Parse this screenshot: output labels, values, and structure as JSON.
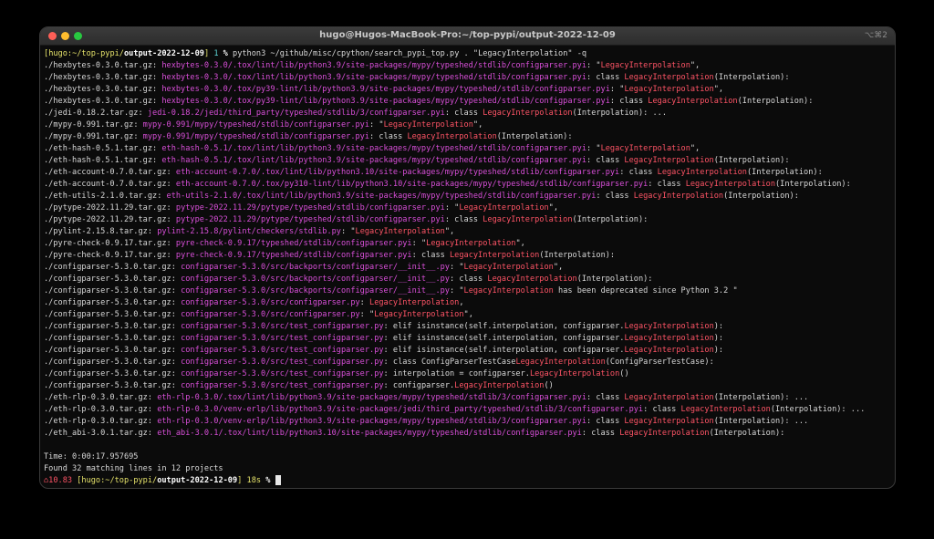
{
  "window": {
    "title": "hugo@Hugos-MacBook-Pro:~/top-pypi/output-2022-12-09",
    "shortcut": "⌥⌘2"
  },
  "prompt1": {
    "open": "[",
    "user": "hugo",
    "path_prefix": ":~/top-pypi/",
    "path_bold": "output-2022-12-09",
    "close": "]",
    "count": " 1 ",
    "symbol": "%",
    "command": " python3 ~/github/misc/cpython/search_pypi_top.py . \"LegacyInterpolation\" -q"
  },
  "results": [
    {
      "pkg": "./hexbytes-0.3.0.tar.gz",
      "path": "hexbytes-0.3.0/.tox/lint/lib/python3.9/site-packages/mypy/typeshed/stdlib/configparser.pyi",
      "pre": "\"",
      "match": "LegacyInterpolation",
      "post": "\","
    },
    {
      "pkg": "./hexbytes-0.3.0.tar.gz",
      "path": "hexbytes-0.3.0/.tox/lint/lib/python3.9/site-packages/mypy/typeshed/stdlib/configparser.pyi",
      "pre": "class ",
      "match": "LegacyInterpolation",
      "post": "(Interpolation):"
    },
    {
      "pkg": "./hexbytes-0.3.0.tar.gz",
      "path": "hexbytes-0.3.0/.tox/py39-lint/lib/python3.9/site-packages/mypy/typeshed/stdlib/configparser.pyi",
      "pre": "\"",
      "match": "LegacyInterpolation",
      "post": "\","
    },
    {
      "pkg": "./hexbytes-0.3.0.tar.gz",
      "path": "hexbytes-0.3.0/.tox/py39-lint/lib/python3.9/site-packages/mypy/typeshed/stdlib/configparser.pyi",
      "pre": "class ",
      "match": "LegacyInterpolation",
      "post": "(Interpolation):"
    },
    {
      "pkg": "./jedi-0.18.2.tar.gz",
      "path": "jedi-0.18.2/jedi/third_party/typeshed/stdlib/3/configparser.pyi",
      "pre": "class ",
      "match": "LegacyInterpolation",
      "post": "(Interpolation): ..."
    },
    {
      "pkg": "./mypy-0.991.tar.gz",
      "path": "mypy-0.991/mypy/typeshed/stdlib/configparser.pyi",
      "pre": "\"",
      "match": "LegacyInterpolation",
      "post": "\","
    },
    {
      "pkg": "./mypy-0.991.tar.gz",
      "path": "mypy-0.991/mypy/typeshed/stdlib/configparser.pyi",
      "pre": "class ",
      "match": "LegacyInterpolation",
      "post": "(Interpolation):"
    },
    {
      "pkg": "./eth-hash-0.5.1.tar.gz",
      "path": "eth-hash-0.5.1/.tox/lint/lib/python3.9/site-packages/mypy/typeshed/stdlib/configparser.pyi",
      "pre": "\"",
      "match": "LegacyInterpolation",
      "post": "\","
    },
    {
      "pkg": "./eth-hash-0.5.1.tar.gz",
      "path": "eth-hash-0.5.1/.tox/lint/lib/python3.9/site-packages/mypy/typeshed/stdlib/configparser.pyi",
      "pre": "class ",
      "match": "LegacyInterpolation",
      "post": "(Interpolation):"
    },
    {
      "pkg": "./eth-account-0.7.0.tar.gz",
      "path": "eth-account-0.7.0/.tox/lint/lib/python3.10/site-packages/mypy/typeshed/stdlib/configparser.pyi",
      "pre": "class ",
      "match": "LegacyInterpolation",
      "post": "(Interpolation):"
    },
    {
      "pkg": "./eth-account-0.7.0.tar.gz",
      "path": "eth-account-0.7.0/.tox/py310-lint/lib/python3.10/site-packages/mypy/typeshed/stdlib/configparser.pyi",
      "pre": "class ",
      "match": "LegacyInterpolation",
      "post": "(Interpolation):"
    },
    {
      "pkg": "./eth-utils-2.1.0.tar.gz",
      "path": "eth-utils-2.1.0/.tox/lint/lib/python3.9/site-packages/mypy/typeshed/stdlib/configparser.pyi",
      "pre": "class ",
      "match": "LegacyInterpolation",
      "post": "(Interpolation):"
    },
    {
      "pkg": "./pytype-2022.11.29.tar.gz",
      "path": "pytype-2022.11.29/pytype/typeshed/stdlib/configparser.pyi",
      "pre": "\"",
      "match": "LegacyInterpolation",
      "post": "\","
    },
    {
      "pkg": "./pytype-2022.11.29.tar.gz",
      "path": "pytype-2022.11.29/pytype/typeshed/stdlib/configparser.pyi",
      "pre": "class ",
      "match": "LegacyInterpolation",
      "post": "(Interpolation):"
    },
    {
      "pkg": "./pylint-2.15.8.tar.gz",
      "path": "pylint-2.15.8/pylint/checkers/stdlib.py",
      "pre": "\"",
      "match": "LegacyInterpolation",
      "post": "\","
    },
    {
      "pkg": "./pyre-check-0.9.17.tar.gz",
      "path": "pyre-check-0.9.17/typeshed/stdlib/configparser.pyi",
      "pre": "\"",
      "match": "LegacyInterpolation",
      "post": "\","
    },
    {
      "pkg": "./pyre-check-0.9.17.tar.gz",
      "path": "pyre-check-0.9.17/typeshed/stdlib/configparser.pyi",
      "pre": "class ",
      "match": "LegacyInterpolation",
      "post": "(Interpolation):"
    },
    {
      "pkg": "./configparser-5.3.0.tar.gz",
      "path": "configparser-5.3.0/src/backports/configparser/__init__.py",
      "pre": "\"",
      "match": "LegacyInterpolation",
      "post": "\","
    },
    {
      "pkg": "./configparser-5.3.0.tar.gz",
      "path": "configparser-5.3.0/src/backports/configparser/__init__.py",
      "pre": "class ",
      "match": "LegacyInterpolation",
      "post": "(Interpolation):"
    },
    {
      "pkg": "./configparser-5.3.0.tar.gz",
      "path": "configparser-5.3.0/src/backports/configparser/__init__.py",
      "pre": "\"",
      "match": "LegacyInterpolation",
      "post": " has been deprecated since Python 3.2 \""
    },
    {
      "pkg": "./configparser-5.3.0.tar.gz",
      "path": "configparser-5.3.0/src/configparser.py",
      "pre": "",
      "match": "LegacyInterpolation",
      "post": ","
    },
    {
      "pkg": "./configparser-5.3.0.tar.gz",
      "path": "configparser-5.3.0/src/configparser.py",
      "pre": "\"",
      "match": "LegacyInterpolation",
      "post": "\","
    },
    {
      "pkg": "./configparser-5.3.0.tar.gz",
      "path": "configparser-5.3.0/src/test_configparser.py",
      "pre": "elif isinstance(self.interpolation, configparser.",
      "match": "LegacyInterpolation",
      "post": "):"
    },
    {
      "pkg": "./configparser-5.3.0.tar.gz",
      "path": "configparser-5.3.0/src/test_configparser.py",
      "pre": "elif isinstance(self.interpolation, configparser.",
      "match": "LegacyInterpolation",
      "post": "):"
    },
    {
      "pkg": "./configparser-5.3.0.tar.gz",
      "path": "configparser-5.3.0/src/test_configparser.py",
      "pre": "elif isinstance(self.interpolation, configparser.",
      "match": "LegacyInterpolation",
      "post": "):"
    },
    {
      "pkg": "./configparser-5.3.0.tar.gz",
      "path": "configparser-5.3.0/src/test_configparser.py",
      "pre": "class ConfigParserTestCase",
      "match": "LegacyInterpolation",
      "post": "(ConfigParserTestCase):"
    },
    {
      "pkg": "./configparser-5.3.0.tar.gz",
      "path": "configparser-5.3.0/src/test_configparser.py",
      "pre": "interpolation = configparser.",
      "match": "LegacyInterpolation",
      "post": "()"
    },
    {
      "pkg": "./configparser-5.3.0.tar.gz",
      "path": "configparser-5.3.0/src/test_configparser.py",
      "pre": "configparser.",
      "match": "LegacyInterpolation",
      "post": "()"
    },
    {
      "pkg": "./eth-rlp-0.3.0.tar.gz",
      "path": "eth-rlp-0.3.0/.tox/lint/lib/python3.9/site-packages/mypy/typeshed/stdlib/3/configparser.pyi",
      "pre": "class ",
      "match": "LegacyInterpolation",
      "post": "(Interpolation): ..."
    },
    {
      "pkg": "./eth-rlp-0.3.0.tar.gz",
      "path": "eth-rlp-0.3.0/venv-erlp/lib/python3.9/site-packages/jedi/third_party/typeshed/stdlib/3/configparser.pyi",
      "pre": "class ",
      "match": "LegacyInterpolation",
      "post": "(Interpolation): ..."
    },
    {
      "pkg": "./eth-rlp-0.3.0.tar.gz",
      "path": "eth-rlp-0.3.0/venv-erlp/lib/python3.9/site-packages/mypy/typeshed/stdlib/3/configparser.pyi",
      "pre": "class ",
      "match": "LegacyInterpolation",
      "post": "(Interpolation): ..."
    },
    {
      "pkg": "./eth_abi-3.0.1.tar.gz",
      "path": "eth_abi-3.0.1/.tox/lint/lib/python3.10/site-packages/mypy/typeshed/stdlib/configparser.pyi",
      "pre": "class ",
      "match": "LegacyInterpolation",
      "post": "(Interpolation):"
    }
  ],
  "summary": {
    "time": "Time: 0:00:17.957695",
    "found": "Found 32 matching lines in 12 projects"
  },
  "prompt2": {
    "load": "⌂10.83",
    "open": " [",
    "user": "hugo",
    "path_prefix": ":~/top-pypi/",
    "path_bold": "output-2022-12-09",
    "close": "]",
    "duration": " 18s",
    "symbol": " %"
  },
  "colors": {
    "path": "#d94fd9",
    "match": "#ff5466",
    "prompt_yellow": "#e5e26a",
    "prompt_cyan": "#5fd7d7",
    "text": "#d8d8d8"
  }
}
